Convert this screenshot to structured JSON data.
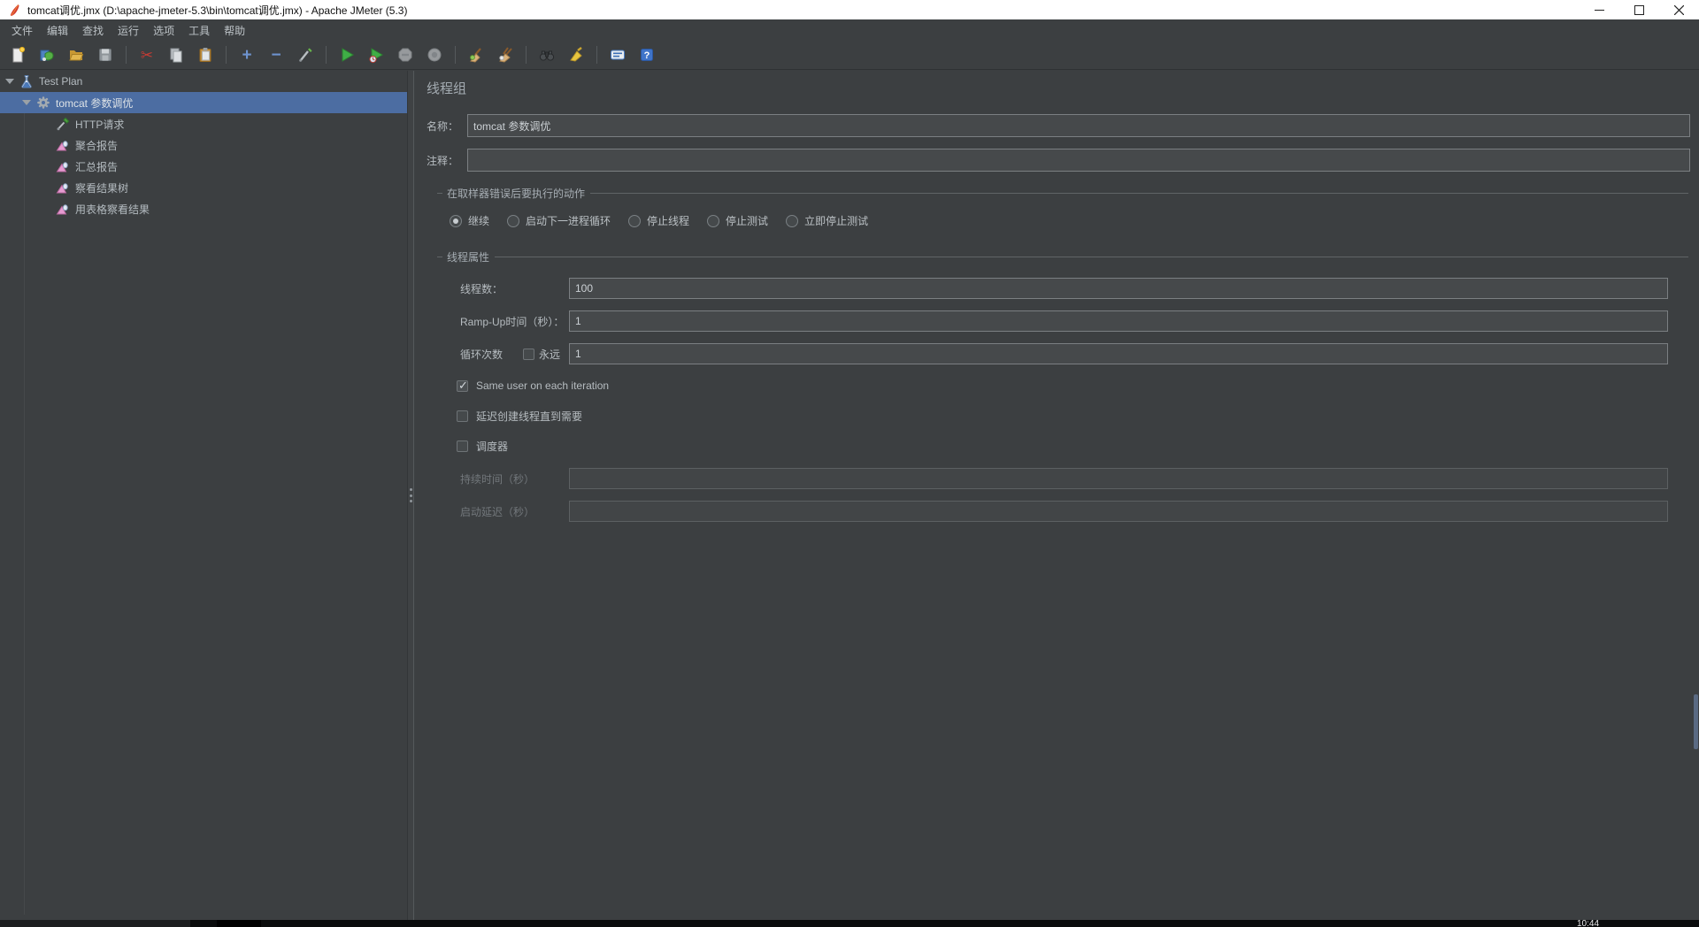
{
  "window": {
    "title": "tomcat调优.jmx (D:\\apache-jmeter-5.3\\bin\\tomcat调优.jmx) - Apache JMeter (5.3)"
  },
  "menu": {
    "items": [
      {
        "label": "文件"
      },
      {
        "label": "编辑"
      },
      {
        "label": "查找"
      },
      {
        "label": "运行"
      },
      {
        "label": "选项"
      },
      {
        "label": "工具"
      },
      {
        "label": "帮助"
      }
    ]
  },
  "toolbar": {
    "icons": [
      "new-file",
      "open-template",
      "open-file",
      "save",
      "cut",
      "copy",
      "paste",
      "expand-all",
      "collapse-all",
      "toggle",
      "start",
      "start-no-pauses",
      "stop",
      "shutdown",
      "clear",
      "clear-all",
      "search",
      "search-reset",
      "function-helper",
      "help"
    ]
  },
  "tree": {
    "items": [
      {
        "label": "Test Plan",
        "icon": "test-plan-flask",
        "level": 0,
        "expanded": true,
        "selected": false
      },
      {
        "label": "tomcat 参数调优",
        "icon": "thread-group-gear",
        "level": 1,
        "expanded": true,
        "selected": true
      },
      {
        "label": "HTTP请求",
        "icon": "http-request-dropper",
        "level": 2,
        "selected": false
      },
      {
        "label": "聚合报告",
        "icon": "report-chart",
        "level": 2,
        "selected": false
      },
      {
        "label": "汇总报告",
        "icon": "report-chart",
        "level": 2,
        "selected": false
      },
      {
        "label": "察看结果树",
        "icon": "report-chart",
        "level": 2,
        "selected": false
      },
      {
        "label": "用表格察看结果",
        "icon": "report-chart",
        "level": 2,
        "selected": false
      }
    ]
  },
  "main": {
    "panel_title": "线程组",
    "name_label": "名称：",
    "name_value": "tomcat 参数调优",
    "comment_label": "注释：",
    "comment_value": "",
    "error_action": {
      "legend": "在取样器错误后要执行的动作",
      "options": [
        {
          "label": "继续",
          "selected": true
        },
        {
          "label": "启动下一进程循环",
          "selected": false
        },
        {
          "label": "停止线程",
          "selected": false
        },
        {
          "label": "停止测试",
          "selected": false
        },
        {
          "label": "立即停止测试",
          "selected": false
        }
      ]
    },
    "thread_props": {
      "legend": "线程属性",
      "threads_label": "线程数：",
      "threads_value": "100",
      "rampup_label": "Ramp-Up时间（秒）：",
      "rampup_value": "1",
      "loop_label": "循环次数",
      "forever_label": "永远",
      "forever_checked": false,
      "loop_value": "1",
      "same_user_label": "Same user on each iteration",
      "same_user_checked": true,
      "delay_create_label": "延迟创建线程直到需要",
      "delay_create_checked": false,
      "scheduler_label": "调度器",
      "scheduler_checked": false,
      "duration_label": "持续时间（秒）",
      "duration_value": "",
      "startup_delay_label": "启动延迟（秒）",
      "startup_delay_value": ""
    }
  },
  "taskbar": {
    "clock": "10:44"
  },
  "colors": {
    "panel_bg": "#3c3f41",
    "selection_blue": "#4c6da2",
    "titlebar_bg": "#ffffff",
    "start_green": "#3fae46",
    "accent_blue": "#6e93cf"
  }
}
